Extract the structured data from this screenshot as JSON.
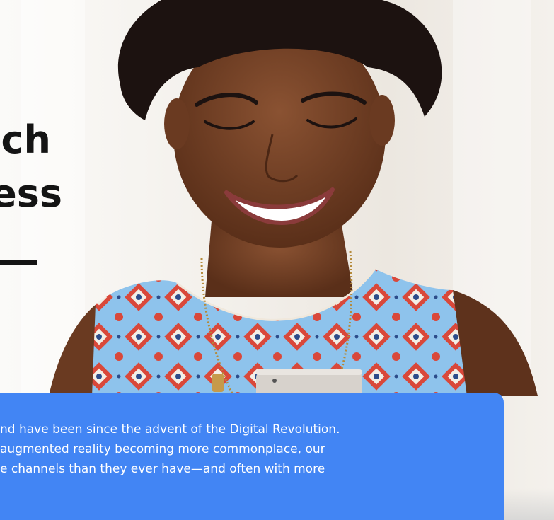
{
  "hero": {
    "headline_lines": [
      "ch",
      "ess"
    ]
  },
  "info_card": {
    "lines": [
      "nd have been since the advent of the Digital Revolution.",
      " augmented reality becoming more commonplace, our",
      "e channels than they ever have—and often with more"
    ]
  },
  "colors": {
    "card_blue": "#4285f4",
    "headline": "#141414",
    "dress_blue": "#8ec3ec",
    "pattern_red": "#d9483a",
    "skin": "#6b3b22",
    "hair": "#1c1210"
  }
}
